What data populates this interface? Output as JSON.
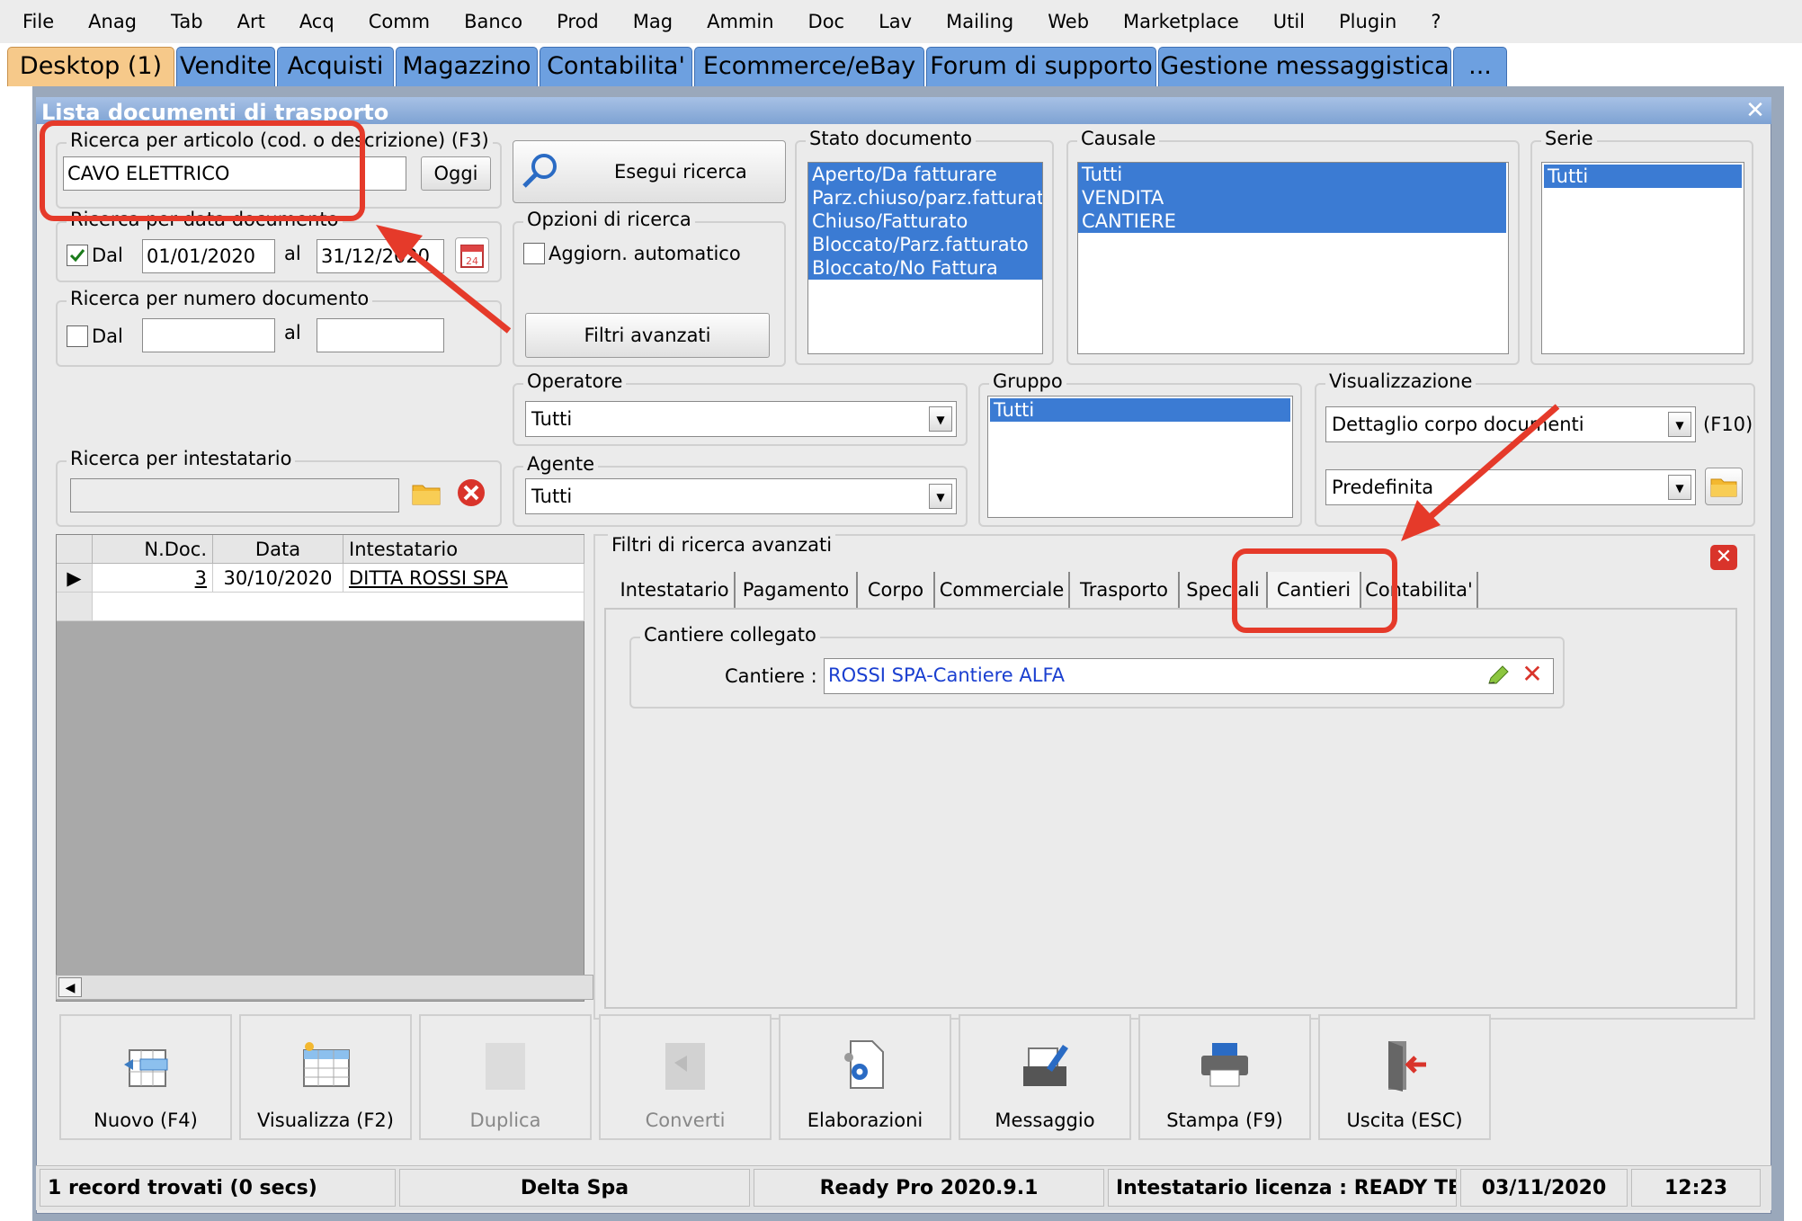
{
  "menu": [
    "File",
    "Anag",
    "Tab",
    "Art",
    "Acq",
    "Comm",
    "Banco",
    "Prod",
    "Mag",
    "Ammin",
    "Doc",
    "Lav",
    "Mailing",
    "Web",
    "Marketplace",
    "Util",
    "Plugin",
    "?"
  ],
  "tabs": [
    "Desktop (1)",
    "Vendite",
    "Acquisti",
    "Magazzino",
    "Contabilita'",
    "Ecommerce/eBay",
    "Forum di supporto",
    "Gestione messaggistica",
    "..."
  ],
  "window": {
    "title": "Lista documenti di trasporto",
    "close": "✕"
  },
  "ricerca_articolo": {
    "legend": "Ricerca per articolo (cod. o descrizione) (F3)",
    "value": "CAVO ELETTRICO",
    "oggi": "Oggi"
  },
  "ricerca_data": {
    "legend": "Ricerca per data documento",
    "dal_label": "Dal",
    "dal_checked": true,
    "from": "01/01/2020",
    "al_label": "al",
    "to": "31/12/2020"
  },
  "ricerca_numero": {
    "legend": "Ricerca per numero documento",
    "dal_label": "Dal",
    "dal_checked": false,
    "from": "",
    "al_label": "al",
    "to": ""
  },
  "ricerca_intestatario": {
    "legend": "Ricerca per intestatario",
    "value": ""
  },
  "esegui": "Esegui ricerca",
  "opzioni": {
    "legend": "Opzioni di ricerca",
    "aggiorn": "Aggiorn. automatico",
    "filtri": "Filtri avanzati"
  },
  "stato": {
    "legend": "Stato documento",
    "items": [
      "Aperto/Da fatturare",
      "Parz.chiuso/parz.fatturato",
      "Chiuso/Fatturato",
      "Bloccato/Parz.fatturato",
      "Bloccato/No Fattura"
    ]
  },
  "causale": {
    "legend": "Causale",
    "items": [
      "Tutti",
      "VENDITA",
      "CANTIERE"
    ]
  },
  "serie": {
    "legend": "Serie",
    "items": [
      "Tutti"
    ]
  },
  "operatore": {
    "legend": "Operatore",
    "value": "Tutti"
  },
  "agente": {
    "legend": "Agente",
    "value": "Tutti"
  },
  "gruppo": {
    "legend": "Gruppo",
    "items": [
      "Tutti"
    ]
  },
  "visualizzazione": {
    "legend": "Visualizzazione",
    "value1": "Dettaglio corpo documenti",
    "f10": "(F10)",
    "value2": "Predefinita"
  },
  "grid": {
    "headers": [
      "N.Doc.",
      "Data",
      "Intestatario"
    ],
    "rows": [
      {
        "ndoc": "3",
        "data": "30/10/2020",
        "intestatario": "DITTA ROSSI SPA"
      }
    ]
  },
  "advanced": {
    "legend": "Filtri di ricerca avanzati",
    "tabs": [
      "Intestatario",
      "Pagamento",
      "Corpo",
      "Commerciale",
      "Trasporto",
      "Speciali",
      "Cantieri",
      "Contabilita'"
    ],
    "active_tab": "Cantieri",
    "group": "Cantiere collegato",
    "cantiere_label": "Cantiere :",
    "cantiere_value": "ROSSI SPA-Cantiere ALFA"
  },
  "buttons": [
    {
      "label": "Nuovo (F4)",
      "icon": "new-document-icon",
      "enabled": true
    },
    {
      "label": "Visualizza (F2)",
      "icon": "view-table-icon",
      "enabled": true
    },
    {
      "label": "Duplica",
      "icon": "duplicate-icon",
      "enabled": false
    },
    {
      "label": "Converti",
      "icon": "convert-icon",
      "enabled": false
    },
    {
      "label": "Elaborazioni",
      "icon": "gear-document-icon",
      "enabled": true
    },
    {
      "label": "Messaggio",
      "icon": "message-icon",
      "enabled": true
    },
    {
      "label": "Stampa (F9)",
      "icon": "printer-icon",
      "enabled": true
    },
    {
      "label": "Uscita (ESC)",
      "icon": "exit-door-icon",
      "enabled": true
    }
  ],
  "status": {
    "records": "1 record trovati (0 secs)",
    "company": "Delta Spa",
    "version": "Ready Pro 2020.9.1",
    "license": "Intestatario licenza : READY TECNO",
    "date": "03/11/2020",
    "time": "12:23"
  },
  "colors": {
    "selection": "#3b7bd3",
    "tab": "#6da0e0",
    "active_tab": "#f6c98a",
    "highlight": "#e53a2a"
  }
}
